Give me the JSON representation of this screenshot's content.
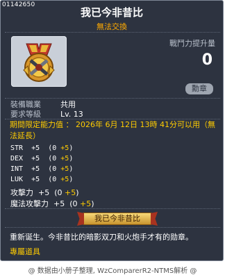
{
  "item": {
    "id": "01142650",
    "name": "我已今非昔比",
    "trade": "無法交換",
    "power_label": "戰鬥力提升量",
    "power_value": "0",
    "category_badge": "勳章"
  },
  "requirements": {
    "job_label": "裝備職業",
    "job_value": "共用",
    "level_label": "要求等級",
    "level_value": "Lv. 13"
  },
  "period": {
    "text": "期間限定能力值 ： 2026年 6月 12日 13時 41分可以用（無法延長）"
  },
  "stats": [
    {
      "name": "STR",
      "value": "+5",
      "base": "(0 ",
      "bonus": "+5",
      "close": ")"
    },
    {
      "name": "DEX",
      "value": "+5",
      "base": "(0 ",
      "bonus": "+5",
      "close": ")"
    },
    {
      "name": "INT",
      "value": "+5",
      "base": "(0 ",
      "bonus": "+5",
      "close": ")"
    },
    {
      "name": "LUK",
      "value": "+5",
      "base": "(0 ",
      "bonus": "+5",
      "close": ")"
    },
    {
      "name": "攻擊力",
      "value": "+5",
      "base": "(0 ",
      "bonus": "+5",
      "close": ")"
    },
    {
      "name": "魔法攻擊力",
      "value": "+5",
      "base": "(0 ",
      "bonus": "+5",
      "close": ")"
    }
  ],
  "medal_tag": "我已今非昔比",
  "description": "重新诞生。今非昔比的暗影双刀和火炮手才有的勋章。",
  "special_label": "專屬道具",
  "footer": "@ 数据由小册子整理, WzComparerR2-NTMS解析 @",
  "colors": {
    "background": "#2d3340",
    "gold": "#ffcc00",
    "orange": "#ffaa00",
    "label_gray": "#b8bfca"
  }
}
